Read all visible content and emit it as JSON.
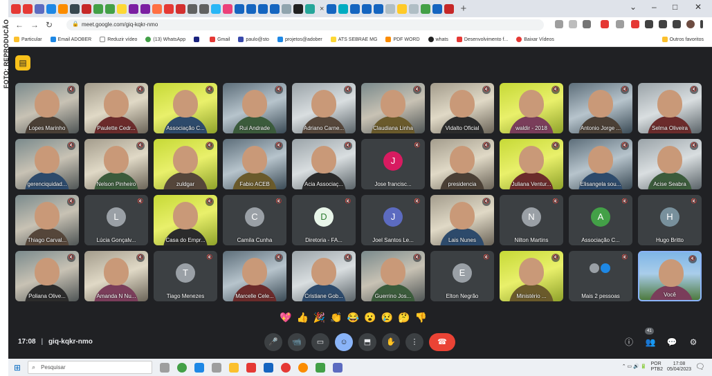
{
  "credit": "FOTO: REPRODUÇÃO",
  "browser": {
    "url": "meet.google.com/giq-kqkr-nmo",
    "new_tab": "+",
    "close_tab": "×",
    "window_controls": [
      "⌄",
      "–",
      "□",
      "✕"
    ],
    "bookmarks": [
      "Particular",
      "Email ADOBER",
      "Reduzir vídeo",
      "(13) WhatsApp",
      "Gmail",
      "paulo@sto",
      "projetos@adober",
      "ATS SEBRAE MG",
      "PDF WORD",
      "whats",
      "Desenvolvimento f...",
      "Baixar Vídeos",
      "Outros favoritos"
    ]
  },
  "participants": [
    {
      "name": "Lopes Marinho",
      "type": "photo"
    },
    {
      "name": "Paulette Cedr...",
      "type": "photo"
    },
    {
      "name": "Associação C...",
      "type": "photo"
    },
    {
      "name": "Rui Andrade",
      "type": "photo"
    },
    {
      "name": "Adriano Carne...",
      "type": "photo"
    },
    {
      "name": "Claudiana Linha",
      "type": "photo"
    },
    {
      "name": "Vidalto Oficial",
      "type": "photo"
    },
    {
      "name": "waldir - 2018",
      "type": "photo"
    },
    {
      "name": "Antonio Jorge ...",
      "type": "photo"
    },
    {
      "name": "Selma Oliveira",
      "type": "photo"
    },
    {
      "name": "gerenciquidad...",
      "type": "photo"
    },
    {
      "name": "Nelson Pinheiro",
      "type": "photo"
    },
    {
      "name": "zuldgar",
      "type": "photo"
    },
    {
      "name": "Fabio ACEB",
      "type": "photo"
    },
    {
      "name": "Acia Associaç...",
      "type": "photo"
    },
    {
      "name": "Jose francisc...",
      "type": "avatar",
      "letter": "J",
      "color": "#d81b60"
    },
    {
      "name": "presidencia",
      "type": "photo"
    },
    {
      "name": "Juliana Ventur...",
      "type": "photo"
    },
    {
      "name": "Elisangela sou...",
      "type": "photo"
    },
    {
      "name": "Acise Seabra",
      "type": "photo"
    },
    {
      "name": "Thiago Carval...",
      "type": "photo"
    },
    {
      "name": "Lúcia Gonçalv...",
      "type": "avatar",
      "letter": "L",
      "color": "#9aa0a6"
    },
    {
      "name": "Casa do Empr...",
      "type": "photo"
    },
    {
      "name": "Camila Cunha",
      "type": "avatar",
      "letter": "C",
      "color": "#9aa0a6"
    },
    {
      "name": "Diretoria - FA...",
      "type": "avatar",
      "letter": "D",
      "color": "#e8f5e9"
    },
    {
      "name": "Joel Santos Le...",
      "type": "avatar",
      "letter": "J",
      "color": "#5c6bc0"
    },
    {
      "name": "Lais Nunes",
      "type": "photo"
    },
    {
      "name": "Nilton Martins",
      "type": "avatar",
      "letter": "N",
      "color": "#9aa0a6"
    },
    {
      "name": "Associação C...",
      "type": "avatar",
      "letter": "A",
      "color": "#43a047"
    },
    {
      "name": "Hugo Britto",
      "type": "avatar",
      "letter": "H",
      "color": "#78909c"
    },
    {
      "name": "Poliana Olive...",
      "type": "photo"
    },
    {
      "name": "Amanda N Nu...",
      "type": "photo"
    },
    {
      "name": "Tiago Menezes",
      "type": "avatar",
      "letter": "T",
      "color": "#9aa0a6"
    },
    {
      "name": "Marcelle Cele...",
      "type": "photo"
    },
    {
      "name": "Cristiane Gob...",
      "type": "photo"
    },
    {
      "name": "Guerrino Jos...",
      "type": "photo"
    },
    {
      "name": "Elton Negrão",
      "type": "avatar",
      "letter": "E",
      "color": "#9aa0a6"
    },
    {
      "name": "Ministério ...",
      "type": "photo"
    },
    {
      "name": "Mais 2 pessoas",
      "type": "more"
    },
    {
      "name": "Você",
      "type": "you"
    }
  ],
  "reactions": [
    "💖",
    "👍",
    "🎉",
    "👏",
    "😂",
    "😮",
    "😢",
    "🤔",
    "👎"
  ],
  "meeting": {
    "time": "17:08",
    "sep": "|",
    "code": "giq-kqkr-nmo"
  },
  "controls": [
    "🎤",
    "📹",
    "▭",
    "☺",
    "⬒",
    "✋",
    "⋮",
    "☎"
  ],
  "right_controls": {
    "info": "ⓘ",
    "people": "👥",
    "people_count": "41",
    "chat": "💬",
    "activities": "⚙"
  },
  "taskbar": {
    "search_placeholder": "Pesquisar",
    "lang": "POR",
    "region": "PTB2",
    "clock_time": "17:08",
    "clock_date": "05/04/2023"
  }
}
